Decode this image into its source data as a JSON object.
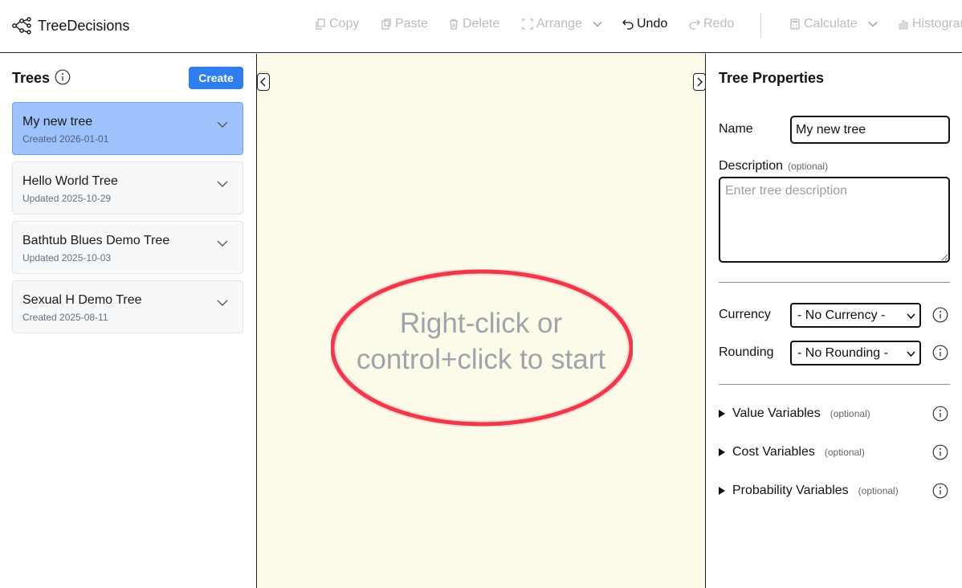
{
  "header": {
    "app_name": "TreeDecisions",
    "toolbar": {
      "copy": "Copy",
      "paste": "Paste",
      "delete": "Delete",
      "arrange": "Arrange",
      "undo": "Undo",
      "redo": "Redo",
      "calculate": "Calculate",
      "histogram": "Histogram"
    }
  },
  "left_panel": {
    "title": "Trees",
    "create_label": "Create",
    "trees": [
      {
        "name": "My new tree",
        "meta": "Created 2026-01-01",
        "selected": true
      },
      {
        "name": "Hello World Tree",
        "meta": "Updated 2025-10-29",
        "selected": false
      },
      {
        "name": "Bathtub Blues Demo Tree",
        "meta": "Updated 2025-10-03",
        "selected": false
      },
      {
        "name": "Sexual H Demo Tree",
        "meta": "Created 2025-08-11",
        "selected": false
      }
    ]
  },
  "canvas": {
    "hint": "Right-click or control+click to start",
    "highlight_color": "#f0384a",
    "background": "#fcfae8"
  },
  "right_panel": {
    "title": "Tree Properties",
    "name_label": "Name",
    "name_value": "My new tree",
    "description_label": "Description",
    "optional": "(optional)",
    "description_placeholder": "Enter tree description",
    "currency_label": "Currency",
    "currency_value": "- No Currency -",
    "rounding_label": "Rounding",
    "rounding_value": "- No Rounding -",
    "sections": [
      {
        "label": "Value Variables",
        "note": "(optional)"
      },
      {
        "label": "Cost Variables",
        "note": "(optional)"
      },
      {
        "label": "Probability Variables",
        "note": "(optional)"
      }
    ]
  },
  "colors": {
    "accent": "#2e7ef0",
    "selected_card": "#9ec2fb",
    "disabled_text": "#b9bcc3"
  }
}
